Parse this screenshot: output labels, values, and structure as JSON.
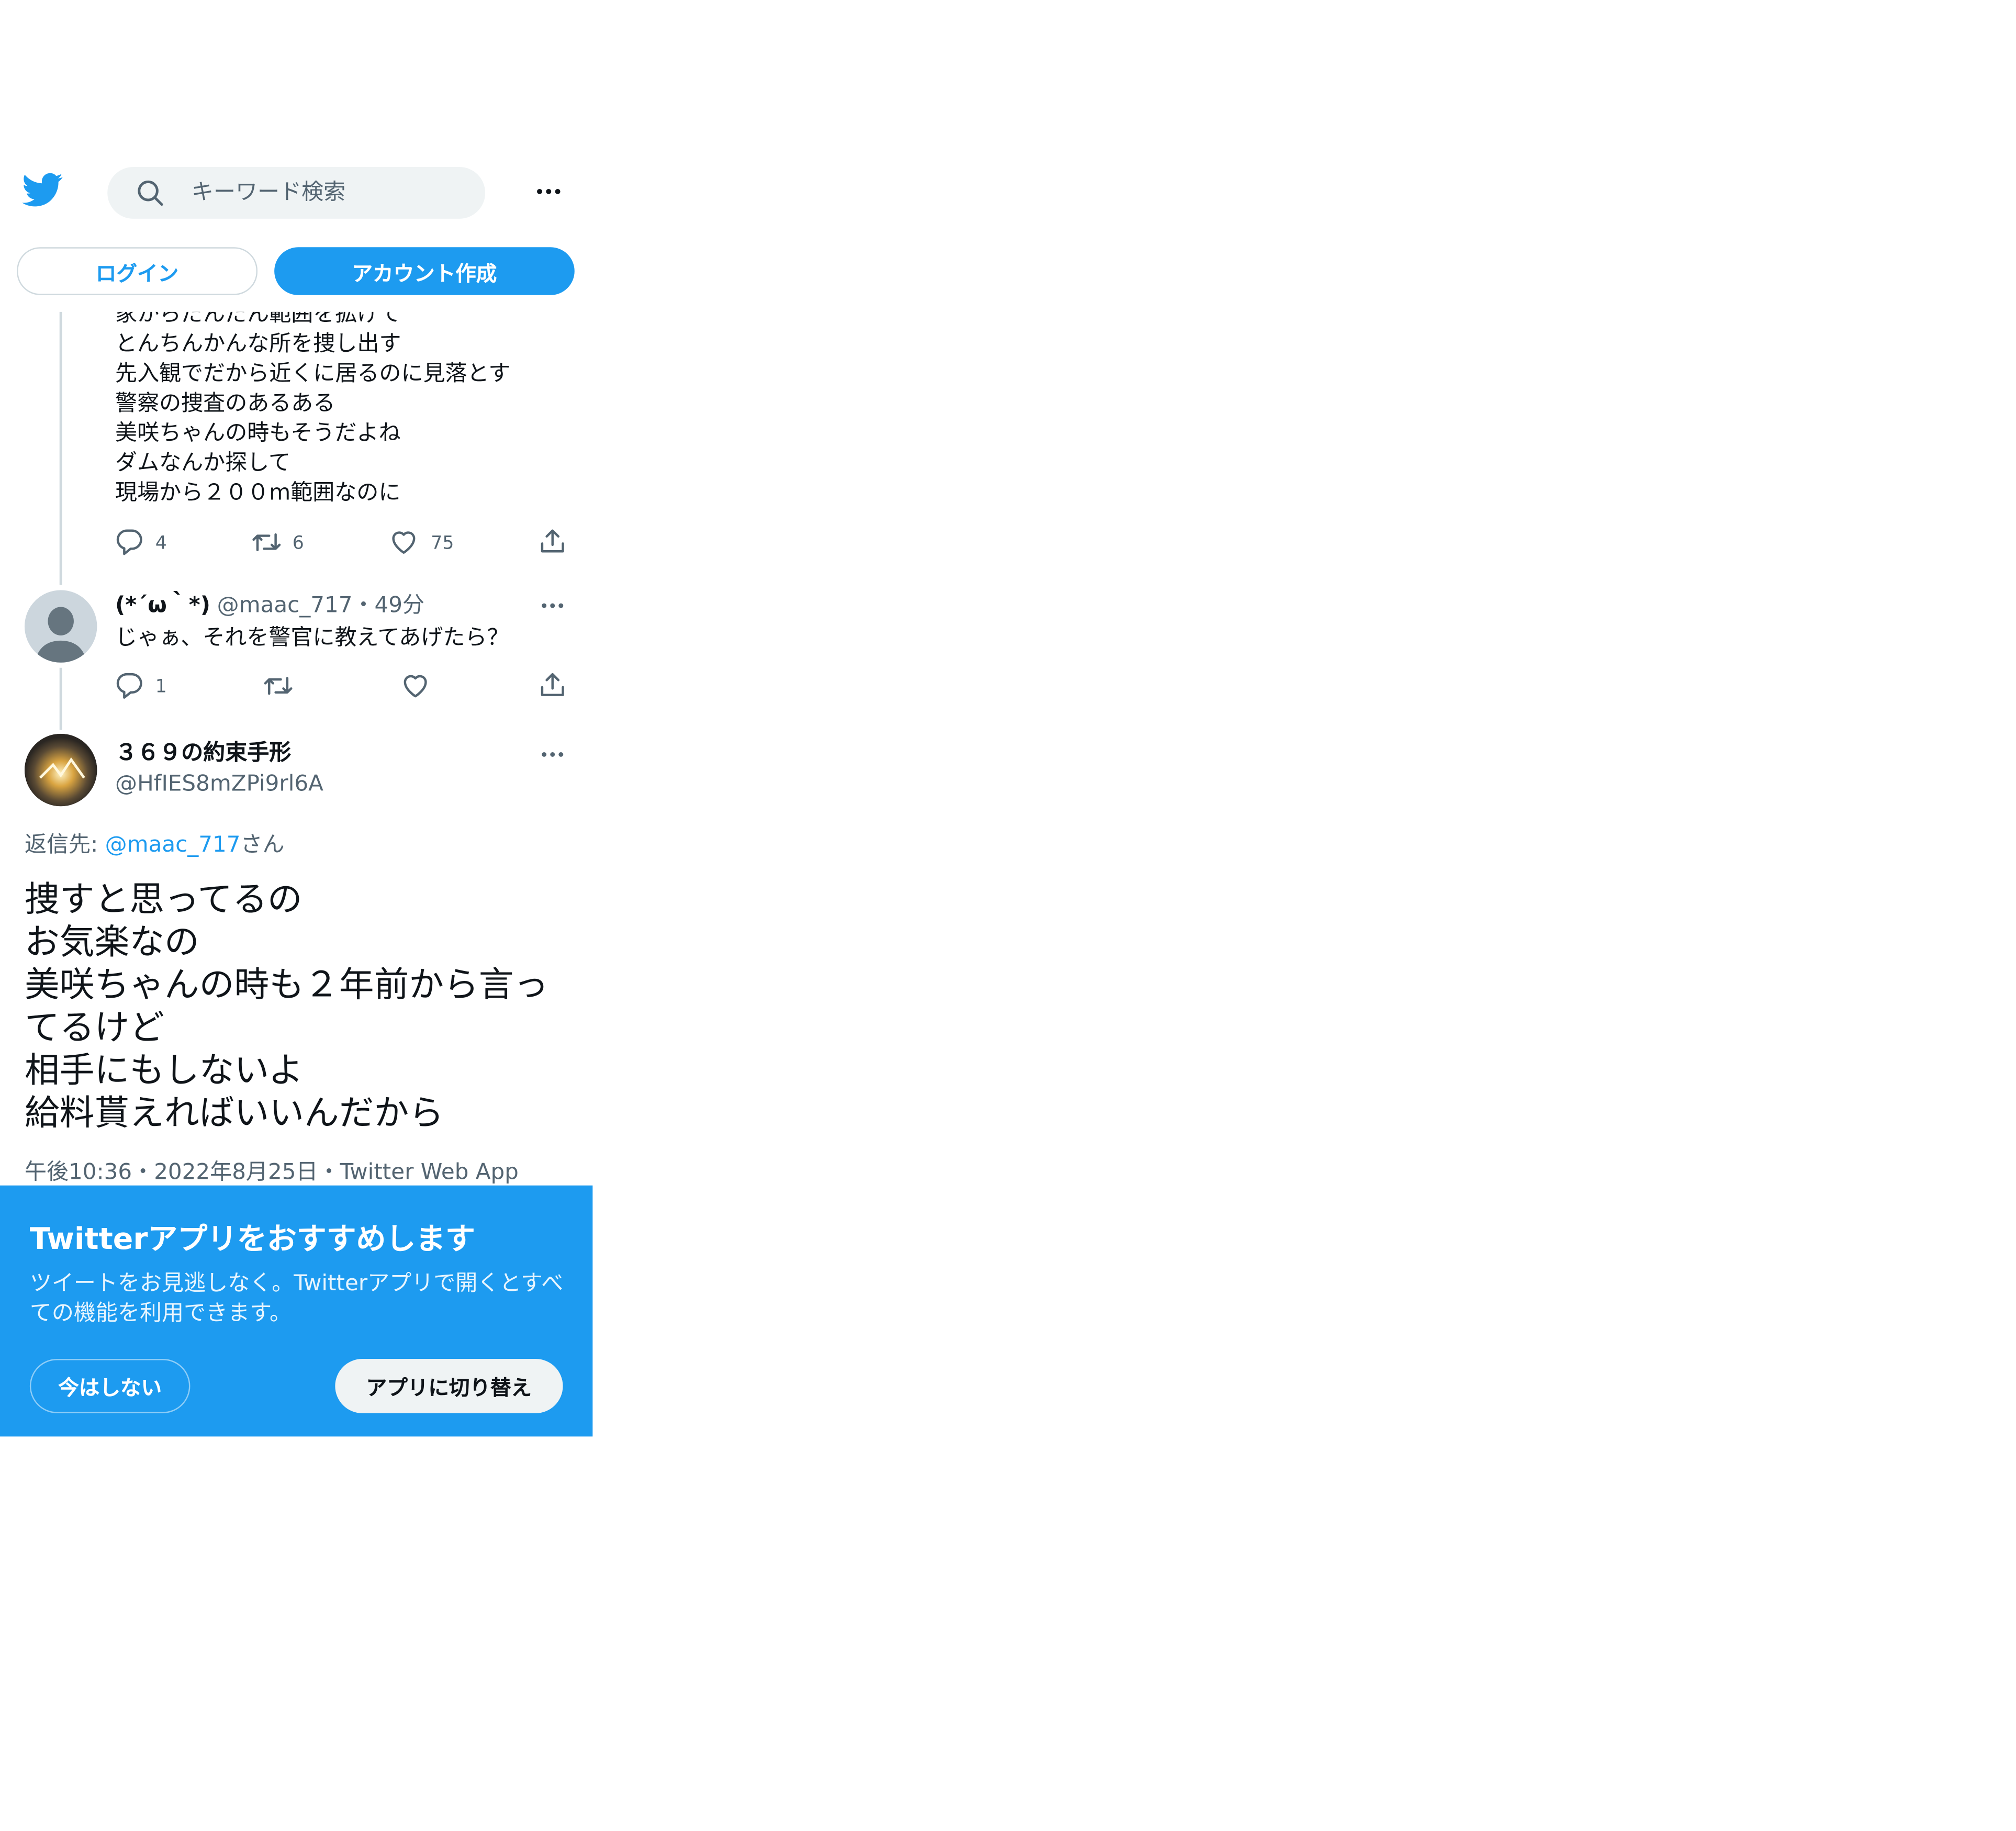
{
  "header": {
    "search_placeholder": "キーワード検索",
    "login_label": "ログイン",
    "signup_label": "アカウント作成"
  },
  "parent_tweet": {
    "lines": [
      "家からだんだん範囲を拡げて",
      "とんちんかんな所を捜し出す",
      "先入観でだから近くに居るのに見落とす",
      "警察の捜査のあるある",
      "美咲ちゃんの時もそうだよね",
      "ダムなんか探して",
      "現場から２００m範囲なのに"
    ],
    "reply_count": "4",
    "retweet_count": "6",
    "like_count": "75"
  },
  "reply_tweet": {
    "name": "(*´ω｀*)",
    "handle": "@maac_717",
    "separator": "・",
    "time": "49分",
    "text": "じゃぁ、それを警官に教えてあげたら？",
    "reply_count": "1"
  },
  "main_tweet": {
    "name": "３６９の約束手形",
    "handle": "@HfIES8mZPi9rl6A",
    "reply_to_prefix": "返信先: ",
    "reply_to_handle": "@maac_717",
    "reply_to_suffix": "さん",
    "lines": [
      "捜すと思ってるの",
      "お気楽なの",
      "美咲ちゃんの時も２年前から言っ",
      "てるけど",
      "相手にもしないよ",
      "給料貰えればいいんだから"
    ],
    "meta": "午後10:36・2022年8月25日・Twitter Web App"
  },
  "app_banner": {
    "title": "Twitterアプリをおすすめします",
    "desc_line1": "ツイートをお見逃しなく。Twitterアプリで開くとすべ",
    "desc_line2": "ての機能を利用できます。",
    "not_now_label": "今はしない",
    "switch_label": "アプリに切り替え"
  },
  "colors": {
    "twitter_blue": "#1d9bf0",
    "text_secondary": "#536471",
    "search_bg": "#eff3f4"
  },
  "icons": {
    "logo": "twitter-bird-icon",
    "search": "search-icon",
    "more": "more-dots-icon",
    "reply": "reply-icon",
    "retweet": "retweet-icon",
    "like": "heart-icon",
    "share": "share-icon"
  }
}
